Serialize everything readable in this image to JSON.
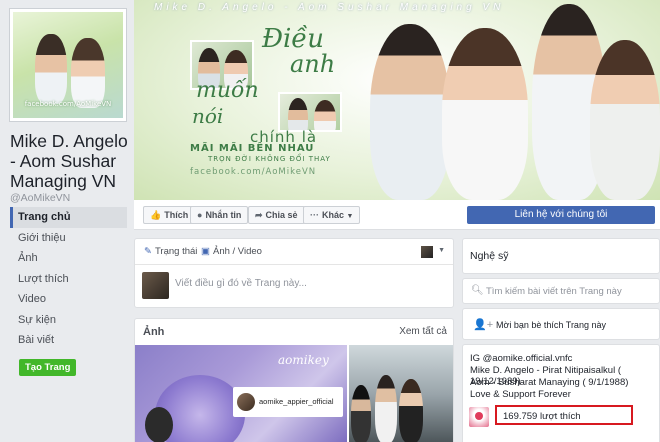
{
  "page": {
    "name": "Mike D. Angelo - Aom Sushar Managing VN",
    "handle": "@AoMikeVN"
  },
  "nav": {
    "items": [
      {
        "label": "Trang chủ"
      },
      {
        "label": "Giới thiệu"
      },
      {
        "label": "Ảnh"
      },
      {
        "label": "Lượt thích"
      },
      {
        "label": "Video"
      },
      {
        "label": "Sự kiện"
      },
      {
        "label": "Bài viết"
      }
    ],
    "create_label": "Tạo Trang"
  },
  "cover": {
    "banner": "Mike D. Angelo - Aom Sushar Managing VN",
    "line1": "Điều",
    "line2": "anh",
    "line3": "muốn",
    "line4": "nói",
    "line5": "chính là",
    "line6": "MÃI MÃI BÊN NHAU",
    "line7": "TRỌN ĐỜI KHÔNG ĐỔI THAY",
    "line8": "facebook.com/AoMikeVN",
    "profile_watermark": "facebook.com/AoMikeVN"
  },
  "actions": {
    "like": "Thích",
    "message": "Nhắn tin",
    "share": "Chia sẻ",
    "more": "Khác",
    "contact": "Liên hệ với chúng tôi"
  },
  "composer": {
    "tab_status": "Trạng thái",
    "tab_photo": "Ảnh / Video",
    "placeholder": "Viết điều gì đó về Trang này..."
  },
  "photos": {
    "title": "Ảnh",
    "see_all": "Xem tất cả",
    "ig_username": "aomike_appier_official",
    "watermark": "aomikey"
  },
  "sidebar": {
    "category": "Nghệ sỹ",
    "search_placeholder": "Tìm kiếm bài viết trên Trang này",
    "invite": "Mời bạn bè thích Trang này",
    "about_lines": [
      "IG @aomike.official.vnfc",
      "Mike D. Angelo - Pirat Nitipaisalkul ( 19/12/1989)",
      "Aom - Susharat Manaying ( 9/1/1988)",
      "Love & Support Forever"
    ],
    "likes": "169.759 lượt thích"
  },
  "colors": {
    "accent": "#4267b2",
    "create": "#42b72a",
    "highlight": "#d71920"
  }
}
